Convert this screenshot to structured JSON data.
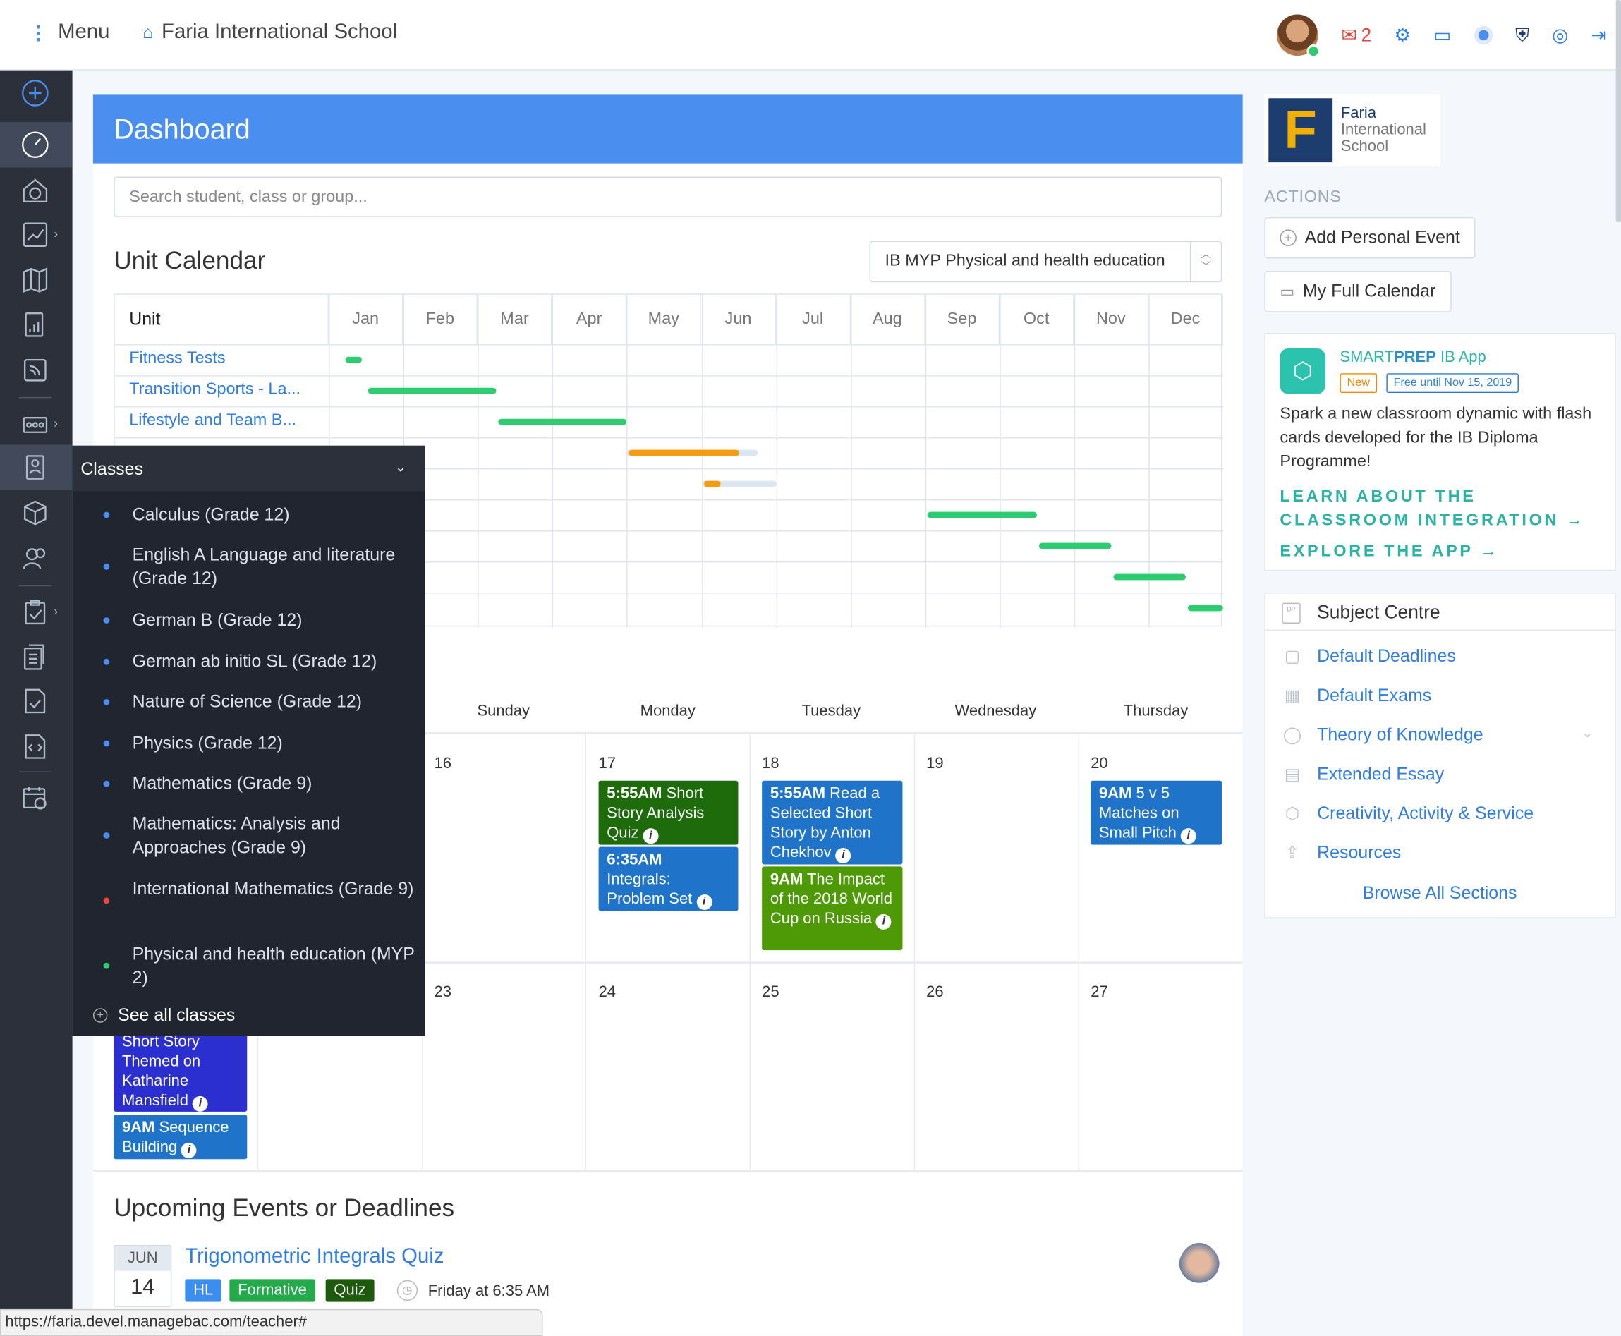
{
  "topbar": {
    "menu_label": "Menu",
    "school_name": "Faria International School",
    "mail_count": "2"
  },
  "dashboard": {
    "title": "Dashboard",
    "search_placeholder": "Search student, class or group..."
  },
  "unit_calendar": {
    "title": "Unit Calendar",
    "selected_class": "IB MYP Physical and health education",
    "unit_header": "Unit",
    "months": [
      "Jan",
      "Feb",
      "Mar",
      "Apr",
      "May",
      "Jun",
      "Jul",
      "Aug",
      "Sep",
      "Oct",
      "Nov",
      "Dec"
    ],
    "units": [
      {
        "label": "Fitness Tests",
        "start": 0.2,
        "end": 0.45,
        "color": "#2ecc71"
      },
      {
        "label": "Transition Sports - La...",
        "start": 0.5,
        "end": 2.25,
        "color": "#2ecc71"
      },
      {
        "label": "Lifestyle and Team B...",
        "start": 2.25,
        "end": 4.0,
        "color": "#2ecc71"
      },
      {
        "label": "",
        "start": 4.0,
        "end": 5.5,
        "color": "#f39c12",
        "tail_end": 5.75
      },
      {
        "label": "",
        "start": 5.0,
        "end": 5.25,
        "color": "#f39c12",
        "tail_end": 6.0
      },
      {
        "label": "",
        "start": 8.0,
        "end": 9.5,
        "color": "#2ecc71"
      },
      {
        "label": "",
        "start": 9.5,
        "end": 10.5,
        "color": "#2ecc71"
      },
      {
        "label": "",
        "start": 10.5,
        "end": 11.5,
        "color": "#2ecc71"
      },
      {
        "label": "",
        "start": 11.5,
        "end": 12.0,
        "color": "#2ecc71"
      }
    ]
  },
  "week_calendar": {
    "day_names": [
      "Sunday",
      "Monday",
      "Tuesday",
      "Wednesday",
      "Thursday"
    ],
    "week1_days": [
      "16",
      "17",
      "18",
      "19",
      "20"
    ],
    "week2_days": [
      "23",
      "24",
      "25",
      "26",
      "27"
    ],
    "events": {
      "mon1": "5:55AM",
      "mon1_text": " Short Story Analysis Quiz",
      "mon2": "6:35AM",
      "mon2_text": " Integrals: Problem Set",
      "tue1": "5:55AM",
      "tue1_text": " Read a Selected Short Story by Anton Chekhov",
      "tue2": "9AM",
      "tue2_text": " The Impact of the 2018 World Cup on Russia",
      "thu1": "9AM",
      "thu1_text": " 5 v 5 Matches on Small Pitch",
      "left1_text": "Short Story Themed on Katharine Mansfield",
      "left2": "9AM",
      "left2_text": " Sequence Building"
    },
    "colors": {
      "dark_green": "#1d6b0b",
      "blue": "#1f74c9",
      "green": "#4e9a06",
      "indigo": "#2b2fd0"
    }
  },
  "upcoming": {
    "title": "Upcoming Events or Deadlines",
    "month": "JUN",
    "day": "14",
    "event_title": "Trigonometric Integrals Quiz",
    "tags": [
      {
        "label": "HL",
        "color": "#3b8ef0"
      },
      {
        "label": "Formative",
        "color": "#22aa4b"
      },
      {
        "label": "Quiz",
        "color": "#1e5a0c"
      }
    ],
    "time": "Friday at 6:35 AM"
  },
  "statusbar_url": "https://faria.devel.managebac.com/teacher#",
  "classes_menu": {
    "title": "Classes",
    "items": [
      {
        "label": "Calculus (Grade 12)",
        "dot": "#4a8ff0"
      },
      {
        "label": "English A Language and literature (Grade 12)",
        "dot": "#4a8ff0"
      },
      {
        "label": "German B (Grade 12)",
        "dot": "#4a8ff0"
      },
      {
        "label": "German ab initio SL (Grade 12)",
        "dot": "#4a8ff0"
      },
      {
        "label": "Nature of Science (Grade 12)",
        "dot": "#4a8ff0"
      },
      {
        "label": "Physics (Grade 12)",
        "dot": "#4a8ff0"
      },
      {
        "label": "Mathematics (Grade 9)",
        "dot": "#4a8ff0"
      },
      {
        "label": "Mathematics: Analysis and Approaches (Grade 9)",
        "dot": "#4a8ff0"
      },
      {
        "label": "International Mathematics (Grade 9)",
        "dot": "#e74c3c"
      },
      {
        "label": "Physical and health education (MYP 2)",
        "dot": "#2ecc71"
      }
    ],
    "see_all": "See all classes"
  },
  "right": {
    "logo_line1": "Faria",
    "logo_line2": "International",
    "logo_line3": "School",
    "actions_label": "ACTIONS",
    "add_event": "Add Personal Event",
    "full_calendar": "My Full Calendar",
    "smartprep": {
      "title_a": "SMART",
      "title_b": "PREP",
      "title_c": " IB App",
      "badge_new": "New",
      "badge_free": "Free until Nov 15, 2019",
      "body": "Spark a new classroom dynamic with flash cards developed for the IB Diploma Programme!",
      "link1": "LEARN ABOUT THE CLASSROOM INTEGRATION →",
      "link2": "EXPLORE THE APP →"
    },
    "subject_centre": {
      "title": "Subject Centre",
      "items": [
        "Default Deadlines",
        "Default Exams",
        "Theory of Knowledge",
        "Extended Essay",
        "Creativity, Activity & Service",
        "Resources"
      ],
      "browse": "Browse All Sections"
    }
  }
}
